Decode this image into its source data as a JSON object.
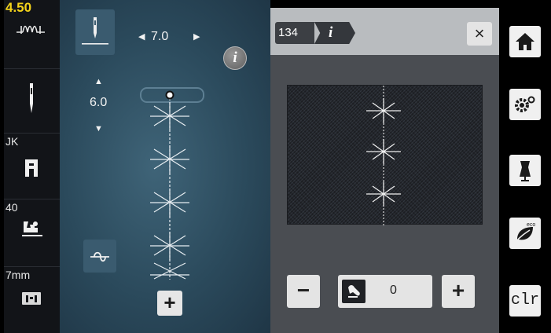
{
  "status_bar": {
    "stitch_length": "4.50",
    "presser_foot_label": "JK",
    "pressure_value": "40",
    "plate_label": "7mm"
  },
  "stitch_settings": {
    "width_value": "7.0",
    "length_value": "6.0",
    "info_glyph": "i",
    "add_glyph": "+"
  },
  "info_panel": {
    "stitch_number": "134",
    "info_glyph": "i",
    "close_glyph": "×",
    "minus_glyph": "−",
    "plus_glyph": "+",
    "foot_pressure_value": "0"
  },
  "toolbar": {
    "clr_label": "clr"
  },
  "icons": [
    "stitch-length-icon",
    "needle-icon",
    "presser-foot-icon",
    "feed-dog-icon",
    "stitch-plate-icon",
    "needle-position-icon",
    "tie-off-icon",
    "info-icon",
    "home-icon",
    "settings-icon",
    "dress-form-icon",
    "eco-icon",
    "close-icon",
    "presser-foot-pressure-icon"
  ],
  "colors": {
    "status_yellow": "#f2d21a",
    "stitch_white": "#ffffff",
    "panel_header": "#b9bcbf",
    "panel_body": "#4a4d52",
    "background_blue": "#2b4a5c"
  }
}
